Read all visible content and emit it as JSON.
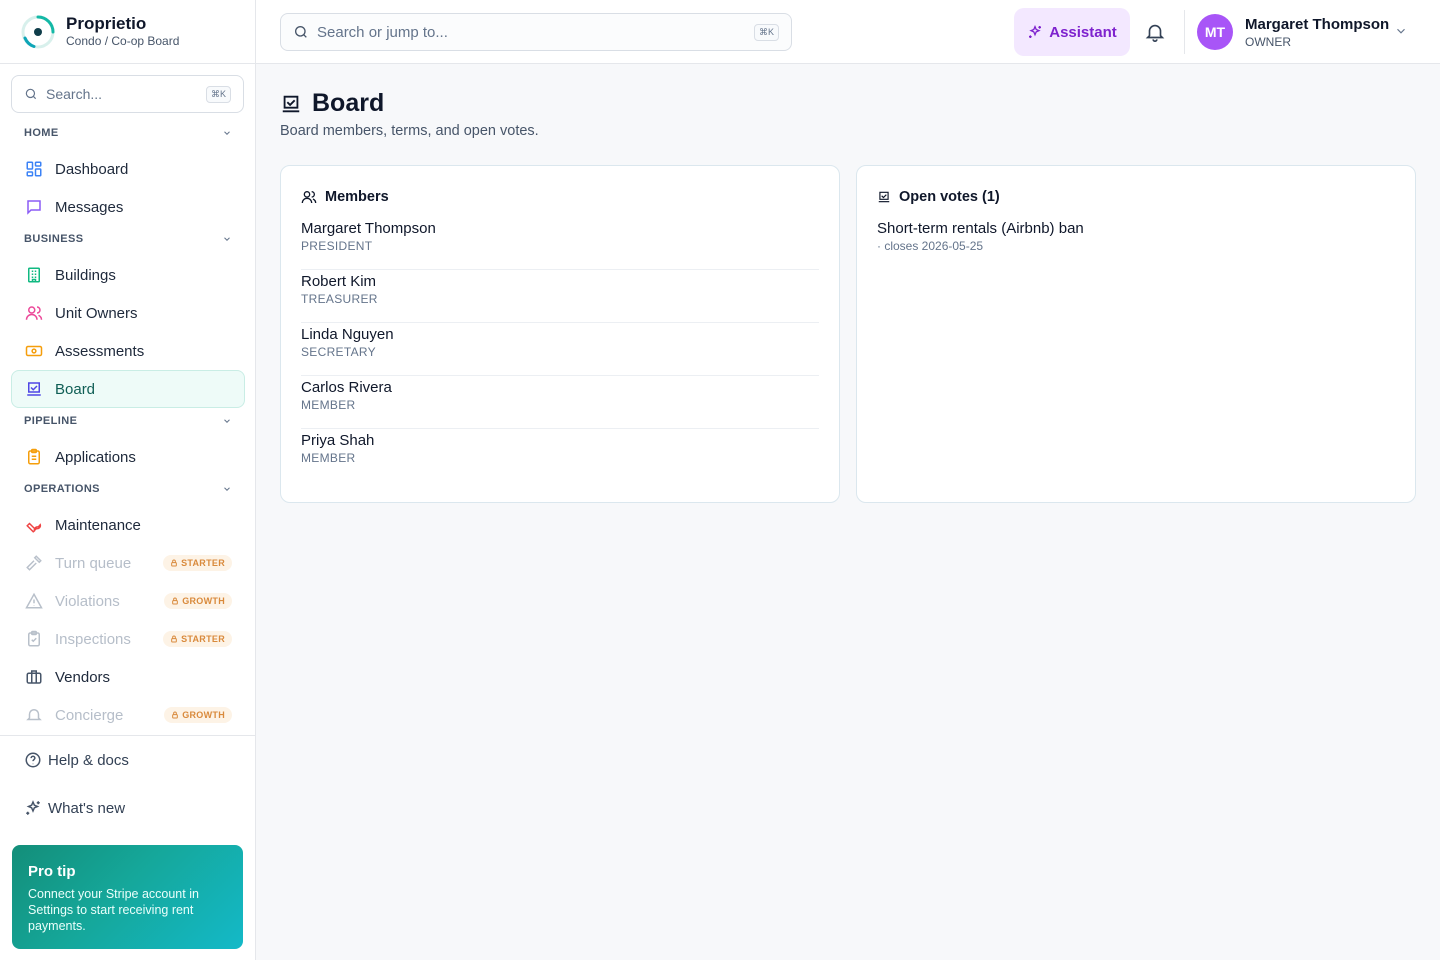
{
  "brand": {
    "name": "Proprietio",
    "subtitle": "Condo / Co-op Board"
  },
  "sidebar": {
    "search_placeholder": "Search...",
    "search_shortcut": "⌘K",
    "sections": [
      {
        "title": "HOME",
        "items": [
          {
            "label": "Dashboard",
            "icon": "dashboard-icon"
          },
          {
            "label": "Messages",
            "icon": "message-icon"
          }
        ]
      },
      {
        "title": "BUSINESS",
        "items": [
          {
            "label": "Buildings",
            "icon": "building-icon"
          },
          {
            "label": "Unit Owners",
            "icon": "users-icon"
          },
          {
            "label": "Assessments",
            "icon": "banknote-icon"
          },
          {
            "label": "Board",
            "icon": "vote-icon",
            "active": true
          }
        ]
      },
      {
        "title": "PIPELINE",
        "items": [
          {
            "label": "Applications",
            "icon": "clipboard-icon"
          }
        ]
      },
      {
        "title": "OPERATIONS",
        "items": [
          {
            "label": "Maintenance",
            "icon": "wrench-icon"
          },
          {
            "label": "Turn queue",
            "icon": "hammer-icon",
            "plan": "STARTER"
          },
          {
            "label": "Violations",
            "icon": "warning-icon",
            "plan": "GROWTH"
          },
          {
            "label": "Inspections",
            "icon": "clipboard-check-icon",
            "plan": "STARTER"
          },
          {
            "label": "Vendors",
            "icon": "briefcase-icon"
          },
          {
            "label": "Concierge",
            "icon": "bell-icon",
            "plan": "GROWTH"
          }
        ]
      }
    ],
    "help_label": "Help & docs",
    "whats_new_label": "What's new",
    "protip": {
      "title": "Pro tip",
      "body": "Connect your Stripe account in Settings to start receiving rent payments."
    }
  },
  "topbar": {
    "search_placeholder": "Search or jump to...",
    "search_shortcut": "⌘K",
    "assistant_label": "Assistant",
    "user": {
      "initials": "MT",
      "name": "Margaret Thompson",
      "role": "OWNER"
    }
  },
  "page": {
    "title": "Board",
    "subtitle": "Board members, terms, and open votes."
  },
  "members": {
    "heading": "Members",
    "list": [
      {
        "name": "Margaret Thompson",
        "role": "PRESIDENT"
      },
      {
        "name": "Robert Kim",
        "role": "TREASURER"
      },
      {
        "name": "Linda Nguyen",
        "role": "SECRETARY"
      },
      {
        "name": "Carlos Rivera",
        "role": "MEMBER"
      },
      {
        "name": "Priya Shah",
        "role": "MEMBER"
      }
    ]
  },
  "votes": {
    "heading": "Open votes (1)",
    "list": [
      {
        "title": "Short-term rentals (Airbnb) ban",
        "meta": "· closes 2026-05-25"
      }
    ]
  },
  "colors": {
    "accent": "#0f5e55",
    "assistant": "#7e22ce",
    "avatar": "#a855f7"
  }
}
